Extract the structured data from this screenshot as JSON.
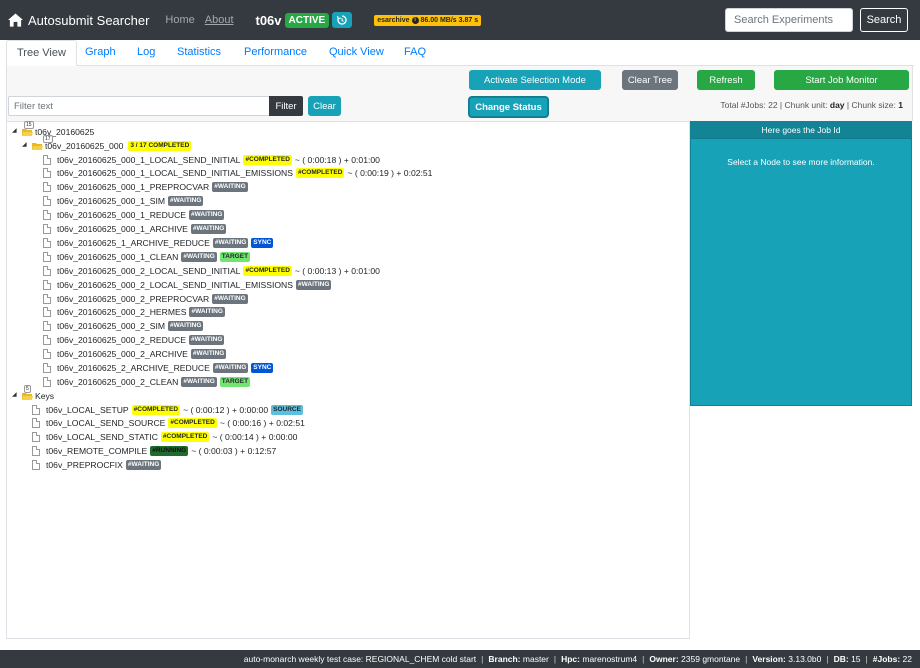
{
  "navbar": {
    "brand": "Autosubmit Searcher",
    "home": "Home",
    "about": "About",
    "experiment": "t06v",
    "status": "ACTIVE",
    "esarchive": "esarchive",
    "esarchive_speed": "86.00 MB/s 3.87 s",
    "search_placeholder": "Search Experiments",
    "search_button": "Search"
  },
  "tabs": [
    "Tree View",
    "Graph",
    "Log",
    "Statistics",
    "Performance",
    "Quick View",
    "FAQ"
  ],
  "controls": {
    "activate": "Activate Selection Mode",
    "clear_tree": "Clear Tree",
    "refresh": "Refresh",
    "start_monitor": "Start Job Monitor",
    "filter_placeholder": "Filter text",
    "filter": "Filter",
    "clear": "Clear",
    "change_status": "Change Status",
    "summary_jobs_label": "Total #Jobs: 22 | Chunk unit:",
    "summary_chunk_unit": "day",
    "summary_chunk_size_label": "| Chunk size:",
    "summary_chunk_size": "1"
  },
  "tree": {
    "root": {
      "label": "t06v_20160625",
      "count": "15"
    },
    "member": {
      "label": "t06v_20160625_000",
      "count": "17",
      "progress": "3 / 17 COMPLETED"
    },
    "jobs": [
      {
        "name": "t06v_20160625_000_1_LOCAL_SEND_INITIAL",
        "status": "#COMPLETED",
        "time": "~ ( 0:00:18 ) + 0:01:00"
      },
      {
        "name": "t06v_20160625_000_1_LOCAL_SEND_INITIAL_EMISSIONS",
        "status": "#COMPLETED",
        "time": "~ ( 0:00:19 ) + 0:02:51"
      },
      {
        "name": "t06v_20160625_000_1_PREPROCVAR",
        "status": "#WAITING"
      },
      {
        "name": "t06v_20160625_000_1_SIM",
        "status": "#WAITING"
      },
      {
        "name": "t06v_20160625_000_1_REDUCE",
        "status": "#WAITING"
      },
      {
        "name": "t06v_20160625_000_1_ARCHIVE",
        "status": "#WAITING"
      },
      {
        "name": "t06v_20160625_1_ARCHIVE_REDUCE",
        "status": "#WAITING",
        "extra": "SYNC"
      },
      {
        "name": "t06v_20160625_000_1_CLEAN",
        "status": "#WAITING",
        "extra": "TARGET"
      },
      {
        "name": "t06v_20160625_000_2_LOCAL_SEND_INITIAL",
        "status": "#COMPLETED",
        "time": "~ ( 0:00:13 ) + 0:01:00"
      },
      {
        "name": "t06v_20160625_000_2_LOCAL_SEND_INITIAL_EMISSIONS",
        "status": "#WAITING"
      },
      {
        "name": "t06v_20160625_000_2_PREPROCVAR",
        "status": "#WAITING"
      },
      {
        "name": "t06v_20160625_000_2_HERMES",
        "status": "#WAITING"
      },
      {
        "name": "t06v_20160625_000_2_SIM",
        "status": "#WAITING"
      },
      {
        "name": "t06v_20160625_000_2_REDUCE",
        "status": "#WAITING"
      },
      {
        "name": "t06v_20160625_000_2_ARCHIVE",
        "status": "#WAITING"
      },
      {
        "name": "t06v_20160625_2_ARCHIVE_REDUCE",
        "status": "#WAITING",
        "extra": "SYNC"
      },
      {
        "name": "t06v_20160625_000_2_CLEAN",
        "status": "#WAITING",
        "extra": "TARGET"
      }
    ],
    "keys": {
      "label": "Keys",
      "count": "5"
    },
    "key_jobs": [
      {
        "name": "t06v_LOCAL_SETUP",
        "status": "#COMPLETED",
        "time": "~ ( 0:00:12 ) + 0:00:00",
        "extra": "SOURCE"
      },
      {
        "name": "t06v_LOCAL_SEND_SOURCE",
        "status": "#COMPLETED",
        "time": "~ ( 0:00:16 ) + 0:02:51"
      },
      {
        "name": "t06v_LOCAL_SEND_STATIC",
        "status": "#COMPLETED",
        "time": "~ ( 0:00:14 ) + 0:00:00"
      },
      {
        "name": "t06v_REMOTE_COMPILE",
        "status": "#RUNNING",
        "time": "~ ( 0:00:03 ) + 0:12:57"
      },
      {
        "name": "t06v_PREPROCFIX",
        "status": "#WAITING"
      }
    ]
  },
  "job_panel": {
    "title": "Here goes the Job Id",
    "message": "Select a Node to see more information."
  },
  "footer": {
    "description": "auto-monarch weekly test case: REGIONAL_CHEM cold start",
    "branch_label": "Branch:",
    "branch": "master",
    "hpc_label": "Hpc:",
    "hpc": "marenostrum4",
    "owner_label": "Owner:",
    "owner": "2359 gmontane",
    "version_label": "Version:",
    "version": "3.13.0b0",
    "db_label": "DB:",
    "db": "15",
    "jobs_label": "#Jobs:",
    "jobs": "22"
  },
  "colors": {
    "navbar": "#343a40",
    "info": "#17a2b8",
    "success": "#28a745",
    "completed": "#ffff00",
    "waiting": "#6c757d"
  }
}
